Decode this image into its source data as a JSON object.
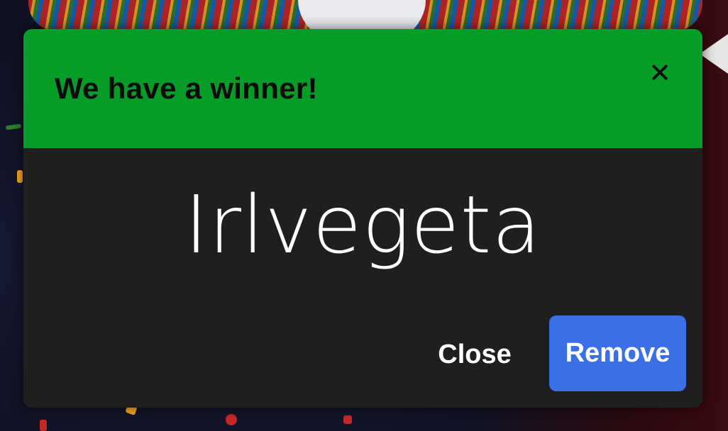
{
  "dialog": {
    "title": "We have a winner!",
    "close_icon": "close-icon",
    "winner": "Irlvegeta",
    "buttons": {
      "close_label": "Close",
      "remove_label": "Remove"
    }
  },
  "colors": {
    "header": "#059c27",
    "body": "#1f1f1f",
    "primary_button": "#3a6fe8",
    "text": "#ffffff"
  }
}
